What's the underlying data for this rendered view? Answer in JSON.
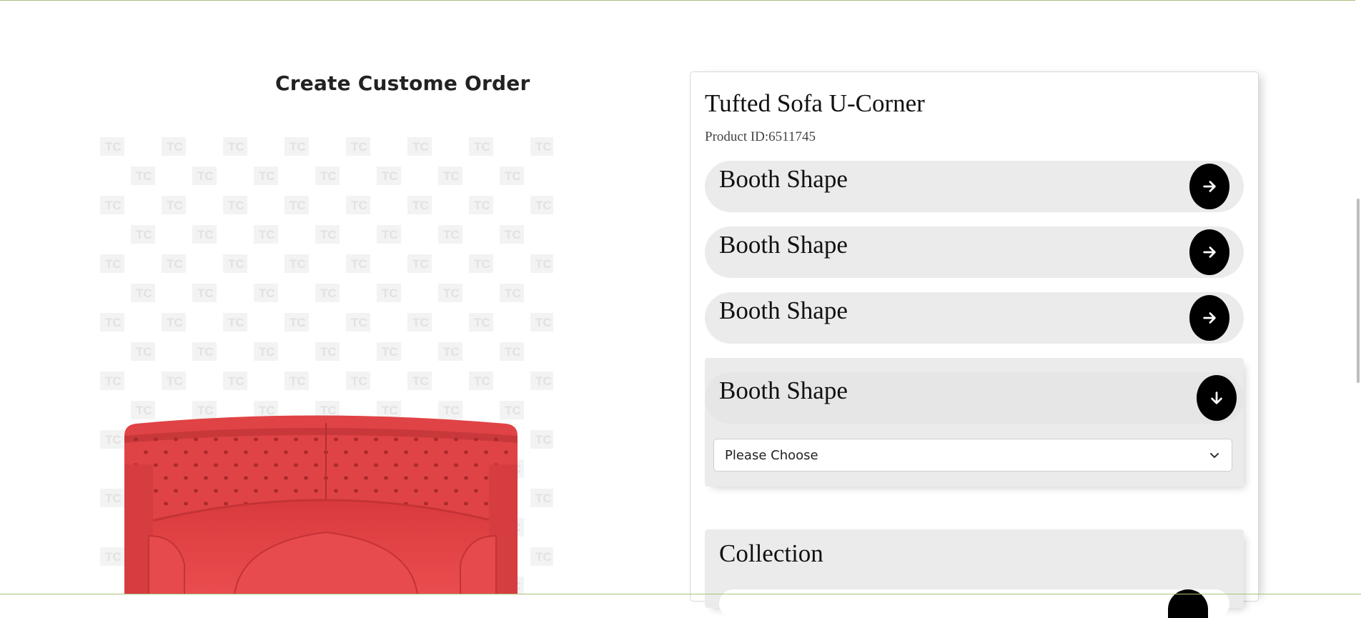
{
  "page": {
    "title": "Create Custome Order"
  },
  "product": {
    "name": "Tufted Sofa U-Corner",
    "id_text": "Product ID:6511745",
    "image_alt": "Red tufted leather sofa U-corner",
    "watermark_text": "TC"
  },
  "options": [
    {
      "label": "Booth Shape",
      "icon": "arrow-right-icon"
    },
    {
      "label": "Booth Shape",
      "icon": "arrow-right-icon"
    },
    {
      "label": "Booth Shape",
      "icon": "arrow-right-icon"
    }
  ],
  "expanded_option": {
    "label": "Booth Shape",
    "icon": "arrow-down-icon",
    "select_value": "Please Choose"
  },
  "collection": {
    "label": "Collection"
  },
  "colors": {
    "accent": "#000000",
    "pill_bg": "#ebebeb",
    "sofa": "#e04345",
    "rule": "#a9c07a"
  }
}
